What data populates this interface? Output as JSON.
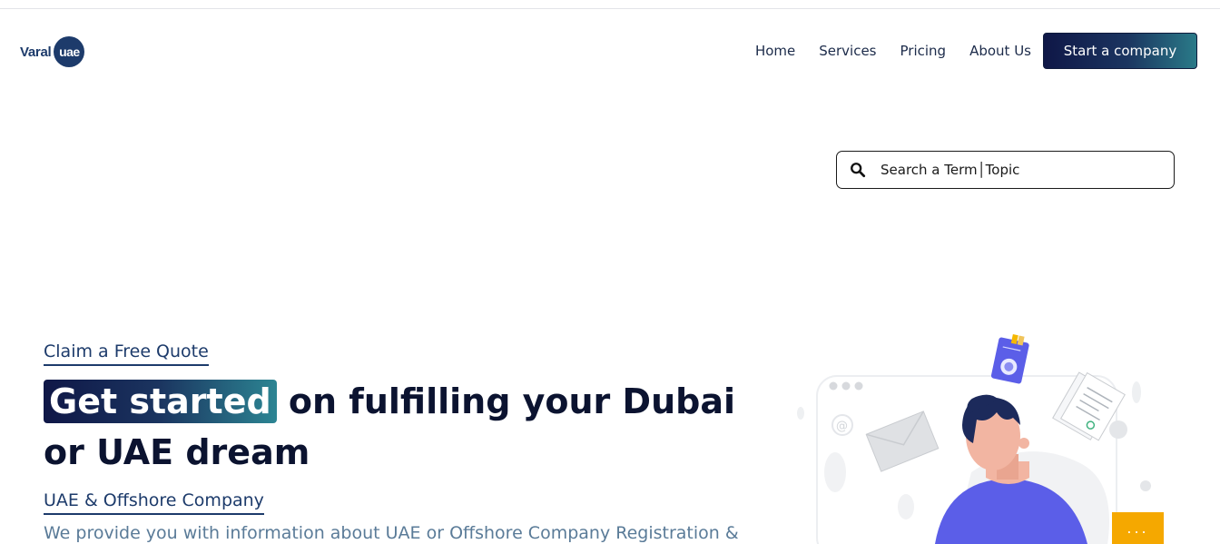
{
  "header": {
    "logo": {
      "text": "Varal",
      "badge": "uae"
    },
    "nav": [
      {
        "label": "Home"
      },
      {
        "label": "Services"
      },
      {
        "label": "Pricing"
      },
      {
        "label": "About Us"
      }
    ],
    "cta_label": "Start a company"
  },
  "search": {
    "placeholder": "Search a Term│Topic",
    "icon": "search-icon"
  },
  "hero": {
    "eyebrow": "Claim a Free Quote",
    "highlight": "Get started",
    "headline_rest": " on fulfilling your Dubai or UAE dream",
    "subhead": "UAE & Offshore Company",
    "description": "We provide you with information about UAE or Offshore Company Registration &"
  },
  "floating_button": {
    "label": "..."
  },
  "colors": {
    "brand_navy": "#1d3b6b",
    "gradient_start": "#0f1747",
    "gradient_end": "#2c8593",
    "accent_orange": "#f5a800",
    "illustration_purple": "#5b5ee8"
  }
}
